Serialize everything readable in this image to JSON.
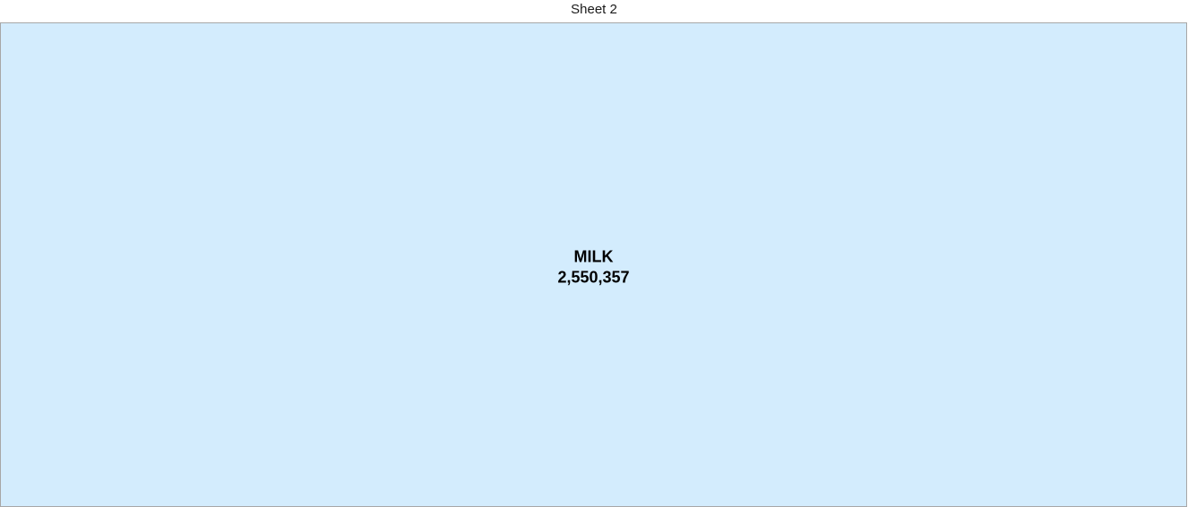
{
  "sheet": {
    "title": "Sheet 2"
  },
  "chart_data": {
    "type": "treemap",
    "title": "",
    "items": [
      {
        "label": "MILK",
        "value": 2550357,
        "value_label": "2,550,357",
        "color": "#d3ecfd"
      }
    ],
    "border_color": "#a7a7a7",
    "text_color": "#000000"
  }
}
